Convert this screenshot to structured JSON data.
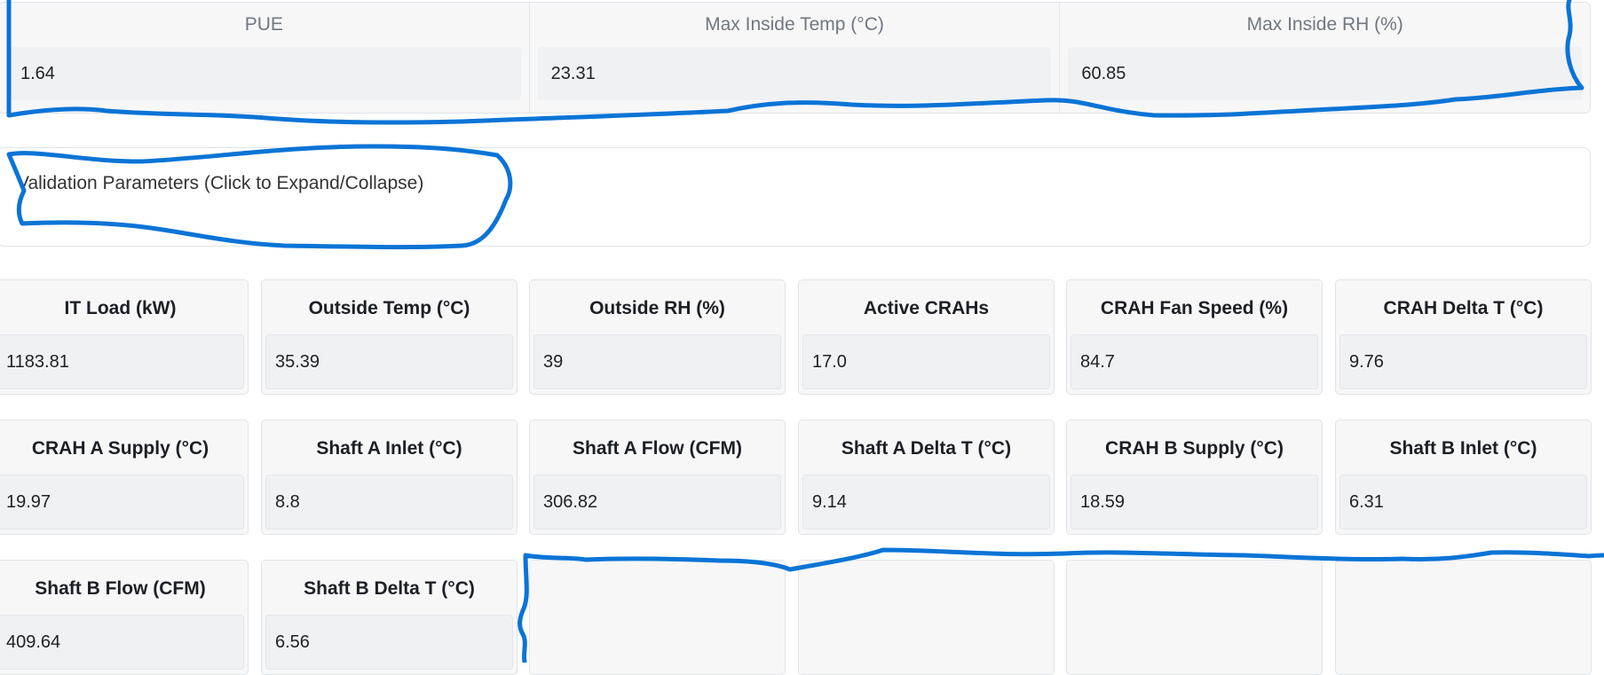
{
  "summary": [
    {
      "label": "PUE",
      "value": "1.64"
    },
    {
      "label": "Max Inside Temp (°C)",
      "value": "23.31"
    },
    {
      "label": "Max Inside RH (%)",
      "value": "60.85"
    }
  ],
  "validation": {
    "title": "Validation Parameters (Click to Expand/Collapse)"
  },
  "params": [
    {
      "label": "IT Load (kW)",
      "value": "1183.81"
    },
    {
      "label": "Outside Temp (°C)",
      "value": "35.39"
    },
    {
      "label": "Outside RH (%)",
      "value": "39"
    },
    {
      "label": "Active CRAHs",
      "value": "17.0"
    },
    {
      "label": "CRAH Fan Speed (%)",
      "value": "84.7"
    },
    {
      "label": "CRAH Delta T (°C)",
      "value": "9.76"
    },
    {
      "label": "CRAH A Supply (°C)",
      "value": "19.97"
    },
    {
      "label": "Shaft A Inlet (°C)",
      "value": "8.8"
    },
    {
      "label": "Shaft A Flow (CFM)",
      "value": "306.82"
    },
    {
      "label": "Shaft A Delta T (°C)",
      "value": "9.14"
    },
    {
      "label": "CRAH B Supply (°C)",
      "value": "18.59"
    },
    {
      "label": "Shaft B Inlet (°C)",
      "value": "6.31"
    },
    {
      "label": "Shaft B Flow (CFM)",
      "value": "409.64"
    },
    {
      "label": "Shaft B Delta T (°C)",
      "value": "6.56"
    }
  ],
  "colors": {
    "annotation_stroke": "#0a74d6",
    "card_background": "#f7f7f8",
    "value_background": "#f0f1f3"
  }
}
